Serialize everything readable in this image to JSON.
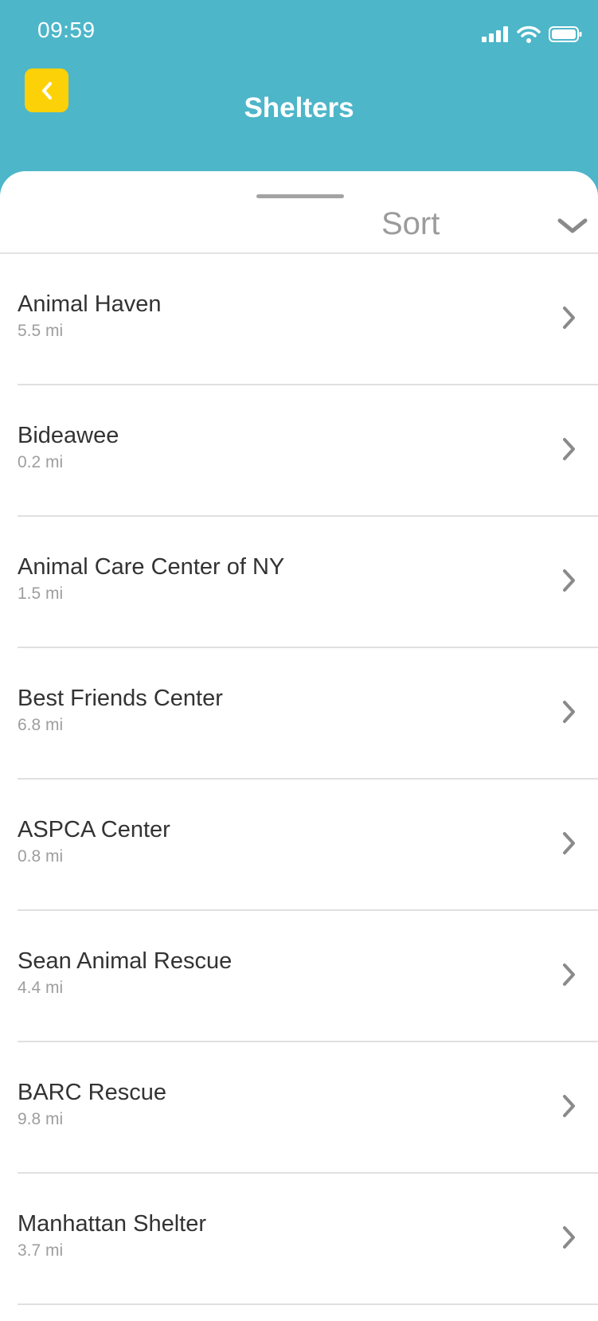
{
  "status_bar": {
    "time": "09:59",
    "icons": [
      "signal-icon",
      "wifi-icon",
      "battery-icon"
    ]
  },
  "header": {
    "title": "Shelters",
    "back_icon": "chevron-left-icon",
    "background_color": "#4db6c9",
    "back_button_color": "#fdd107"
  },
  "sort": {
    "label": "Sort",
    "icon": "chevron-down-icon"
  },
  "shelters": [
    {
      "name": "Animal Haven",
      "distance": "5.5 mi"
    },
    {
      "name": "Bideawee",
      "distance": "0.2 mi"
    },
    {
      "name": "Animal Care Center of NY",
      "distance": "1.5 mi"
    },
    {
      "name": "Best Friends Center",
      "distance": "6.8 mi"
    },
    {
      "name": "ASPCA Center",
      "distance": "0.8 mi"
    },
    {
      "name": "Sean Animal Rescue",
      "distance": "4.4 mi"
    },
    {
      "name": "BARC Rescue",
      "distance": "9.8 mi"
    },
    {
      "name": "Manhattan Shelter",
      "distance": "3.7 mi"
    }
  ]
}
